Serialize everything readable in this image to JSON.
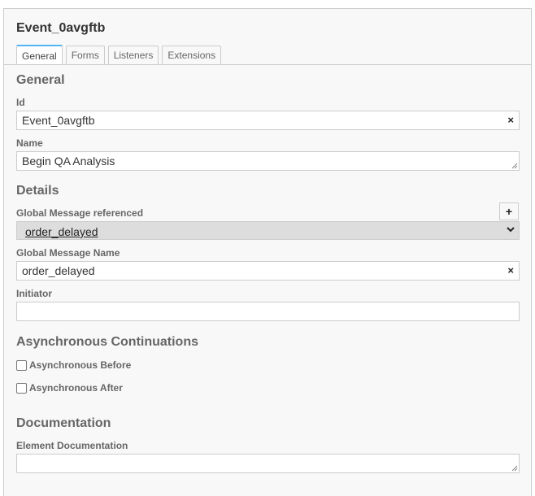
{
  "panel": {
    "title": "Event_0avgftb"
  },
  "tabs": [
    {
      "label": "General",
      "active": true
    },
    {
      "label": "Forms",
      "active": false
    },
    {
      "label": "Listeners",
      "active": false
    },
    {
      "label": "Extensions",
      "active": false
    }
  ],
  "general": {
    "title": "General",
    "id_label": "Id",
    "id_value": "Event_0avgftb",
    "name_label": "Name",
    "name_value": "Begin QA Analysis"
  },
  "details": {
    "title": "Details",
    "global_message_label": "Global Message referenced",
    "global_message_selected": "order_delayed",
    "add_button": "+",
    "global_message_name_label": "Global Message Name",
    "global_message_name_value": "order_delayed",
    "initiator_label": "Initiator",
    "initiator_value": ""
  },
  "async": {
    "title": "Asynchronous Continuations",
    "before_label": "Asynchronous Before",
    "after_label": "Asynchronous After"
  },
  "documentation": {
    "title": "Documentation",
    "element_doc_label": "Element Documentation",
    "element_doc_value": ""
  },
  "icons": {
    "clear": "×"
  },
  "colors": {
    "accent": "#52b4f5",
    "border": "#cccccc",
    "panel_bg": "#f8f8f8"
  }
}
